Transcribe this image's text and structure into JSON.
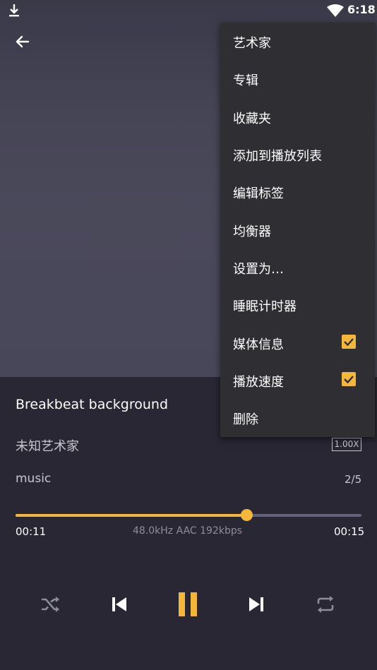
{
  "status_bar": {
    "time": "6:18"
  },
  "now_playing": {
    "title": "Breakbeat background",
    "artist": "未知艺术家",
    "playback_speed": "1.00X",
    "album": "music",
    "queue_position": "2/5",
    "elapsed": "00:11",
    "audio_format": "48.0kHz AAC 192kbps",
    "duration": "00:15",
    "progress_fraction": 0.667
  },
  "menu": {
    "items": [
      {
        "label": "艺术家"
      },
      {
        "label": "专辑"
      },
      {
        "label": "收藏夹"
      },
      {
        "label": "添加到播放列表"
      },
      {
        "label": "编辑标签"
      },
      {
        "label": "均衡器"
      },
      {
        "label": "设置为…"
      },
      {
        "label": "睡眠计时器"
      },
      {
        "label": "媒体信息",
        "checked": true
      },
      {
        "label": "播放速度",
        "checked": true
      },
      {
        "label": "删除"
      }
    ]
  },
  "colors": {
    "accent": "#f5b73a",
    "background": "#282733",
    "menu_background": "#2f2e33",
    "control_inactive": "#8e8d9b"
  },
  "icons": {
    "status_left": "download-icon",
    "status_wifi": "wifi-icon",
    "back": "back-arrow-icon",
    "shuffle": "shuffle-icon",
    "previous": "skip-previous-icon",
    "play_pause": "pause-icon",
    "next": "skip-next-icon",
    "repeat": "repeat-icon"
  }
}
